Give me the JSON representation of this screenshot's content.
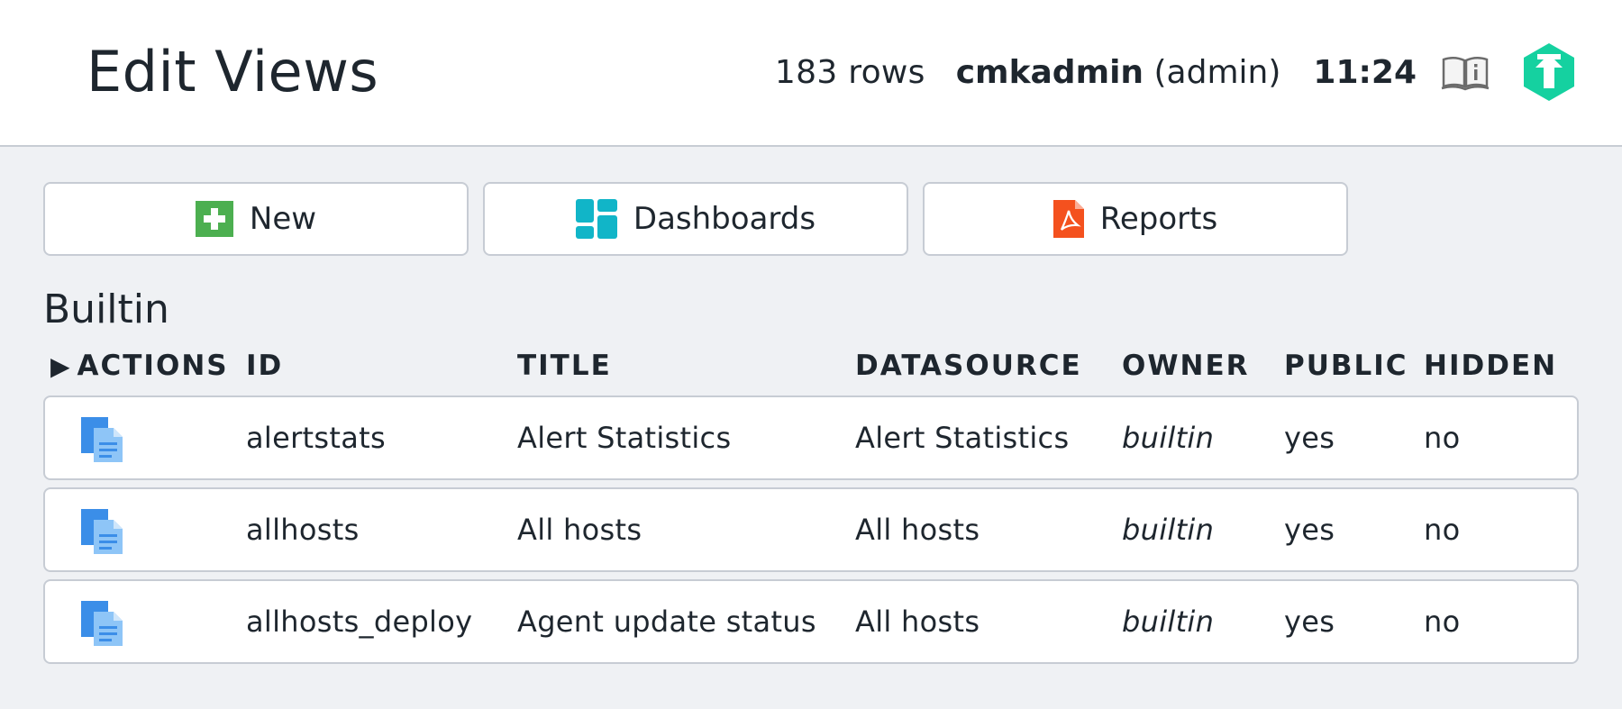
{
  "header": {
    "title": "Edit Views",
    "row_count": "183 rows",
    "username": "cmkadmin",
    "role": "(admin)",
    "time": "11:24"
  },
  "toolbar": {
    "new_label": "New",
    "dashboards_label": "Dashboards",
    "reports_label": "Reports"
  },
  "section": {
    "title": "Builtin"
  },
  "table": {
    "columns": [
      "ACTIONS",
      "ID",
      "TITLE",
      "DATASOURCE",
      "OWNER",
      "PUBLIC",
      "HIDDEN"
    ],
    "rows": [
      {
        "id": "alertstats",
        "title": "Alert Statistics",
        "datasource": "Alert Statistics",
        "owner": "builtin",
        "public": "yes",
        "hidden": "no"
      },
      {
        "id": "allhosts",
        "title": "All hosts",
        "datasource": "All hosts",
        "owner": "builtin",
        "public": "yes",
        "hidden": "no"
      },
      {
        "id": "allhosts_deploy",
        "title": "Agent update status",
        "datasource": "All hosts",
        "owner": "builtin",
        "public": "yes",
        "hidden": "no"
      }
    ]
  },
  "colors": {
    "new_icon": "#4caf50",
    "dashboards_icon": "#11b5c8",
    "reports_icon": "#f4511e",
    "logo": "#15d1a0",
    "copy_icon": "#3b8ee8"
  },
  "icons": [
    "help-book-icon",
    "checkmk-logo-icon",
    "plus-icon",
    "dashboard-icon",
    "pdf-icon",
    "clone-icon",
    "expand-triangle-icon"
  ]
}
